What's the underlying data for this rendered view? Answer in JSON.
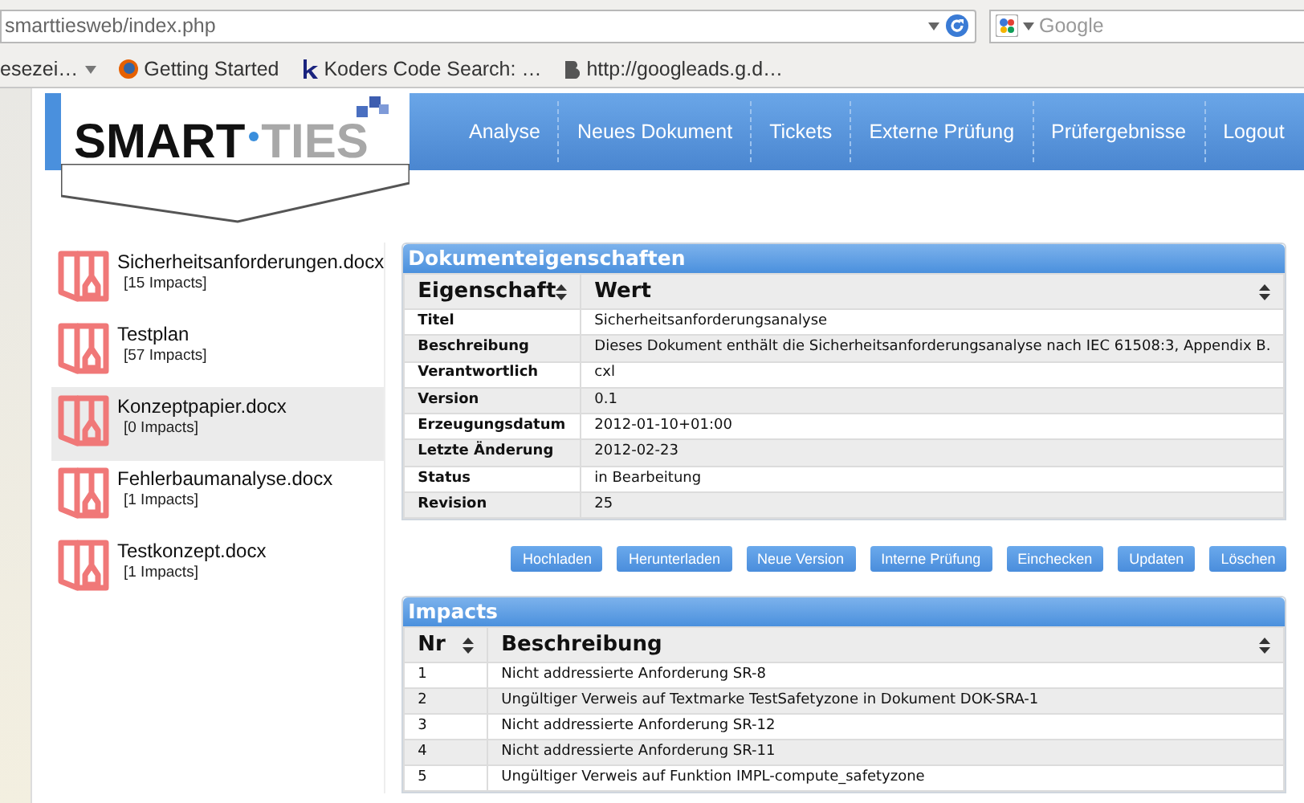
{
  "browser": {
    "url": "smarttiesweb/index.php",
    "search": {
      "placeholder": "Google"
    },
    "bookmarks": [
      {
        "label": "esezei…",
        "kind": "folder"
      },
      {
        "label": "Getting Started",
        "kind": "firefox"
      },
      {
        "label": "Koders Code Search: …",
        "kind": "koders"
      },
      {
        "label": "http://googleads.g.d…",
        "kind": "b"
      }
    ]
  },
  "logo": {
    "part_1": "SMART",
    "part_2": "TIES"
  },
  "nav": [
    "Analyse",
    "Neues Dokument",
    "Tickets",
    "Externe Prüfung",
    "Prüfergebnisse",
    "Logout"
  ],
  "documents": [
    {
      "name": "Sicherheitsanforderungen.docx",
      "impacts": "[15 Impacts]",
      "selected": false
    },
    {
      "name": "Testplan",
      "impacts": "[57 Impacts]",
      "selected": false
    },
    {
      "name": "Konzeptpapier.docx",
      "impacts": "[0 Impacts]",
      "selected": true
    },
    {
      "name": "Fehlerbaumanalyse.docx",
      "impacts": "[1 Impacts]",
      "selected": false
    },
    {
      "name": "Testkonzept.docx",
      "impacts": "[1 Impacts]",
      "selected": false
    }
  ],
  "properties": {
    "title": "Dokumenteigenschaften",
    "columns": [
      "Eigenschaft",
      "Wert"
    ],
    "rows": [
      {
        "label": "Titel",
        "value": "Sicherheitsanforderungsanalyse"
      },
      {
        "label": "Beschreibung",
        "value": "Dieses Dokument enthält die Sicherheitsanforderungsanalyse nach IEC 61508:3, Appendix B."
      },
      {
        "label": "Verantwortlich",
        "value": "cxl"
      },
      {
        "label": "Version",
        "value": "0.1"
      },
      {
        "label": "Erzeugungsdatum",
        "value": "2012-01-10+01:00"
      },
      {
        "label": "Letzte Änderung",
        "value": "2012-02-23"
      },
      {
        "label": "Status",
        "value": "in Bearbeitung"
      },
      {
        "label": "Revision",
        "value": "25"
      }
    ]
  },
  "buttons": [
    "Hochladen",
    "Herunterladen",
    "Neue Version",
    "Interne Prüfung",
    "Einchecken",
    "Updaten",
    "Löschen"
  ],
  "impacts": {
    "title": "Impacts",
    "columns": [
      "Nr",
      "Beschreibung"
    ],
    "rows": [
      {
        "nr": "1",
        "text": "Nicht addressierte Anforderung SR-8"
      },
      {
        "nr": "2",
        "text": "Ungültiger Verweis auf Textmarke TestSafetyzone in Dokument DOK-SRA-1"
      },
      {
        "nr": "3",
        "text": "Nicht addressierte Anforderung SR-12"
      },
      {
        "nr": "4",
        "text": "Nicht addressierte Anforderung SR-11"
      },
      {
        "nr": "5",
        "text": "Ungültiger Verweis auf Funktion IMPL-compute_safetyzone"
      }
    ]
  }
}
